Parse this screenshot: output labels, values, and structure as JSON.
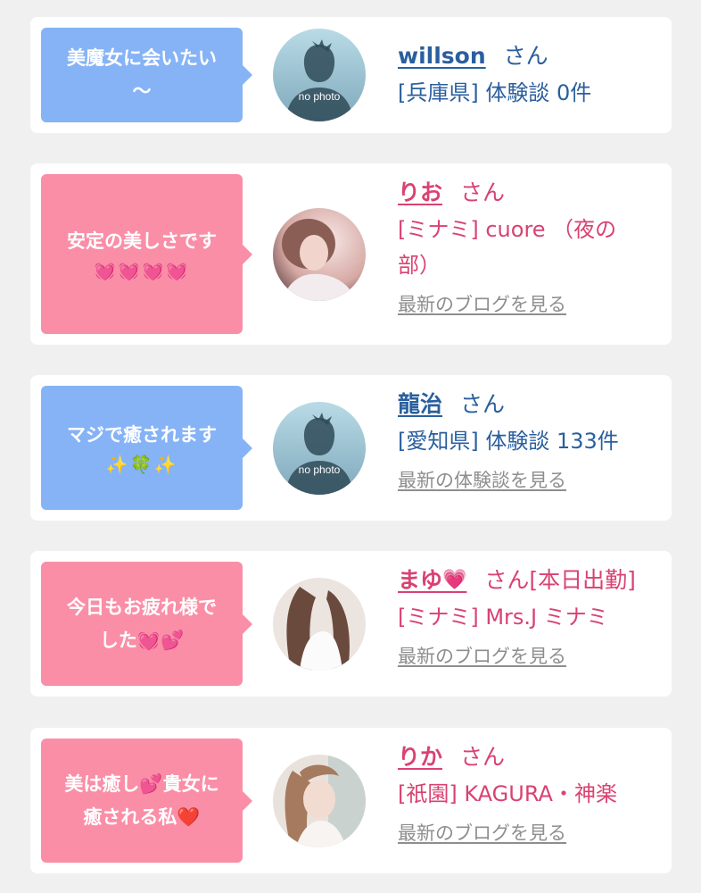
{
  "reviews": [
    {
      "bubble_text": "美魔女に会いたい〜",
      "bubble_line1": "美魔女に会いたい",
      "bubble_line2": "〜",
      "name": "willson",
      "san": "さん",
      "detail": "[兵庫県] 体験談 0件",
      "avatar": "no photo"
    },
    {
      "bubble_text": "安定の美しさです",
      "emoji": "💓💓💓💓",
      "name": "りお",
      "san": "さん",
      "detail_line1": "[ミナミ] cuore （夜の",
      "detail_line2": "部）",
      "more_link": "最新のブログを見る"
    },
    {
      "bubble_text": "マジで癒されます",
      "emoji": "✨🍀✨",
      "name": "龍治",
      "san": "さん",
      "detail": "[愛知県] 体験談 133件",
      "more_link": "最新の体験談を見る",
      "avatar": "no photo"
    },
    {
      "bubble_line1": "今日もお疲れ様で",
      "bubble_line2": "した💓💕",
      "name": "まゆ",
      "name_emoji": "💗",
      "san": "さん[本日出勤]",
      "detail": "[ミナミ] Mrs.J ミナミ",
      "more_link": "最新のブログを見る"
    },
    {
      "bubble_line1": "美は癒し💕貴女に",
      "bubble_line2": "癒される私❤️",
      "name": "りか",
      "san": "さん",
      "detail": "[祇園] KAGURA・神楽",
      "more_link": "最新のブログを見る"
    }
  ],
  "colors": {
    "blue_bubble": "#86b3f5",
    "pink_bubble": "#fa8ea7",
    "blue_text": "#2a5f9e",
    "pink_text": "#d94272",
    "link_gray": "#8e8e8e"
  },
  "icons": [
    "no-photo-silhouette-icon",
    "heart-icon"
  ]
}
